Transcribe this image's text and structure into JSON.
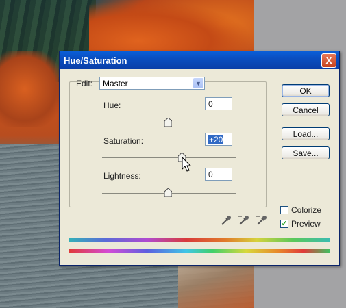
{
  "dialog": {
    "title": "Hue/Saturation",
    "close_label": "X",
    "edit": {
      "label": "Edit:",
      "value": "Master"
    },
    "hue": {
      "label": "Hue:",
      "value": "0"
    },
    "saturation": {
      "label": "Saturation:",
      "value": "+20"
    },
    "lightness": {
      "label": "Lightness:",
      "value": "0"
    },
    "buttons": {
      "ok": "OK",
      "cancel": "Cancel",
      "load": "Load...",
      "save": "Save..."
    },
    "colorize": {
      "label": "Colorize",
      "checked": false
    },
    "preview": {
      "label": "Preview",
      "checked": true
    }
  },
  "icons": [
    "eyedropper-icon",
    "eyedropper-plus-icon",
    "eyedropper-minus-icon",
    "close-icon",
    "chevron-down-icon",
    "mouse-pointer-icon"
  ],
  "colors": {
    "titlebar": "#0a4ec0",
    "dialog_bg": "#ece9d8",
    "close": "#c6431f"
  }
}
